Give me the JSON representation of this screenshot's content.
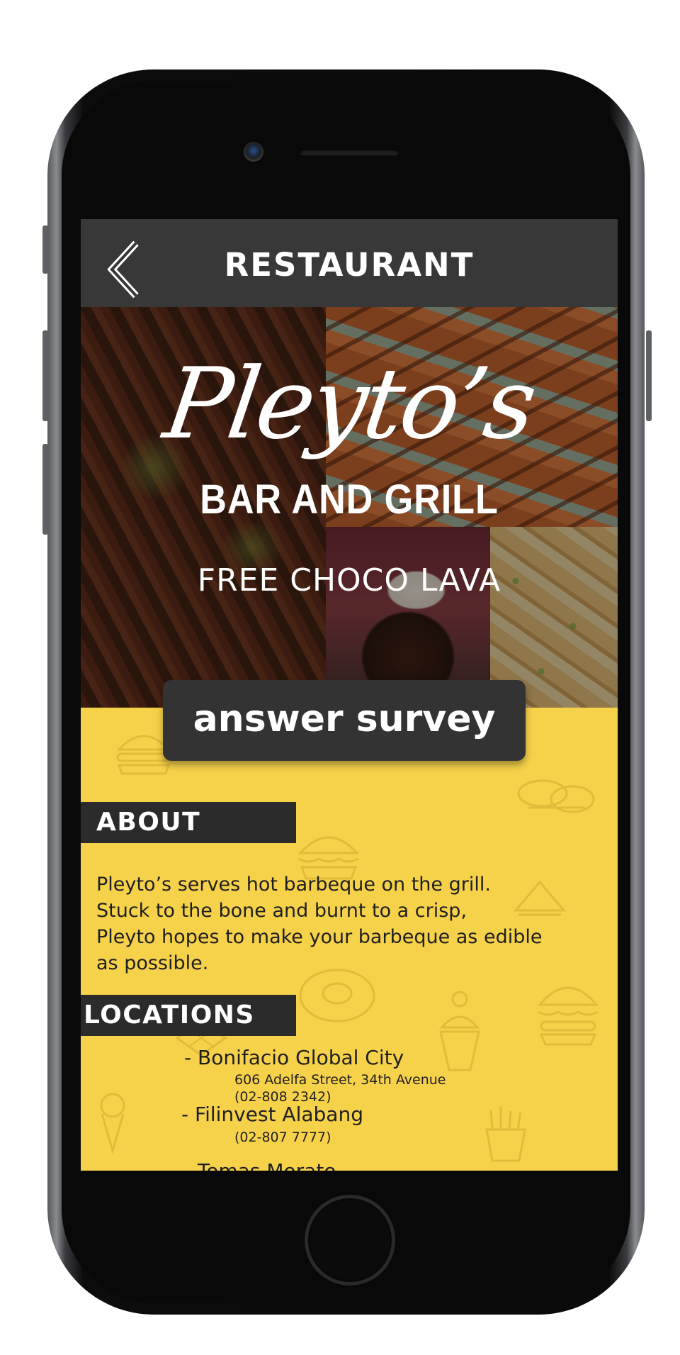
{
  "header": {
    "title": "RESTAURANT",
    "back_icon": "chevron-left-icon"
  },
  "hero": {
    "brand_script": "Pleyto’s",
    "brand_sub": "BAR AND GRILL",
    "promo": "FREE CHOCO LAVA"
  },
  "survey": {
    "label": "answer survey"
  },
  "about": {
    "heading": "ABOUT",
    "lines": [
      "Pleyto’s serves hot barbeque on the grill.",
      "Stuck to the bone and burnt to a crisp,",
      "Pleyto hopes to make your barbeque as edible",
      "as possible."
    ]
  },
  "locations": {
    "heading": "LOCATIONS",
    "items": [
      {
        "name": "- Bonifacio Global City",
        "address": "606 Adelfa Street, 34th Avenue",
        "phone": "(02-808 2342)"
      },
      {
        "name": "- Filinvest Alabang",
        "phone": "(02-807 7777)"
      },
      {
        "name": "- Tomas Morato"
      }
    ]
  },
  "colors": {
    "header_bg": "#383838",
    "accent_yellow": "#f6d24a",
    "section_tag_bg": "#2b2b2b",
    "button_bg": "#333333"
  }
}
